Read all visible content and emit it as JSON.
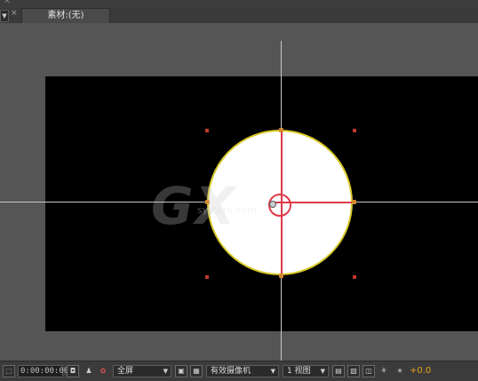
{
  "window": {
    "top_glyph": "×"
  },
  "tabbar": {
    "menu_glyph": "▼",
    "close_glyph": "×",
    "active_tab_label": "素材:(无)"
  },
  "viewer": {
    "watermark": "GX",
    "watermark_sub": "system.com",
    "colors": {
      "background": "#555555",
      "composition": "#000000",
      "shape_fill": "#ffffff",
      "shape_stroke": "#d9c92a",
      "path_highlight": "#e03a4a",
      "handle": "#c0392b"
    }
  },
  "toolbar": {
    "region_icon": "region-of-interest-icon",
    "timecode": "0:00:00:00",
    "snapshot_icon": "camera-icon",
    "show_snapshot_icon": "person-icon",
    "channel_icon": "rgb-channels-icon",
    "resolution": "全屏",
    "resolution_caret": "▼",
    "fast_preview_icon": "region-icon",
    "transparency_grid_icon": "checkerboard-icon",
    "camera": "有效摄像机",
    "camera_caret": "▼",
    "view_layout": "1 视图",
    "view_layout_caret": "▼",
    "pixel_aspect_icon": "pixel-aspect-icon",
    "render_icon": "fast-preview-icon",
    "timeline_icon": "timeline-icon",
    "flowchart_icon": "flowchart-icon",
    "exposure_icon": "exposure-icon",
    "exposure_value": "+0.0"
  }
}
